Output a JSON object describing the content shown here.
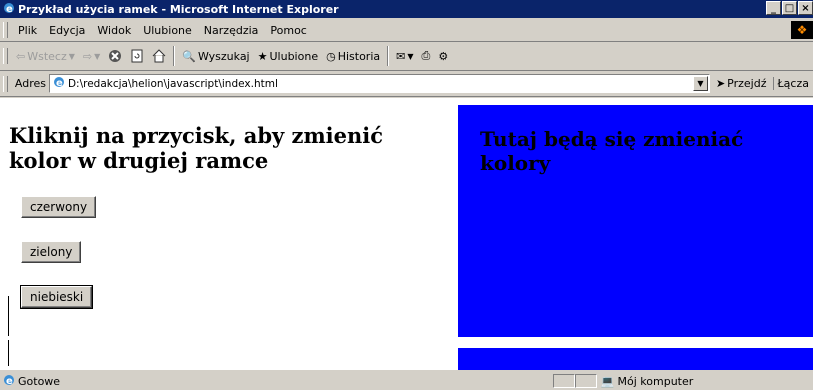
{
  "window": {
    "title": "Przykład użycia ramek - Microsoft Internet Explorer",
    "controls": [
      "_",
      "□",
      "×"
    ]
  },
  "menu": [
    "Plik",
    "Edycja",
    "Widok",
    "Ulubione",
    "Narzędzia",
    "Pomoc"
  ],
  "toolbar": {
    "back_label": "Wstecz",
    "search_label": "Wyszukaj",
    "favorites_label": "Ulubione",
    "history_label": "Historia"
  },
  "address": {
    "label": "Adres",
    "value": "D:\\redakcja\\helion\\javascript\\index.html",
    "go_label": "Przejdź",
    "links_label": "Łącza"
  },
  "left_frame": {
    "heading": "Kliknij na przycisk, aby zmienić kolor w drugiej ramce",
    "buttons": [
      "czerwony",
      "zielony",
      "niebieski"
    ]
  },
  "right_frame": {
    "heading": "Tutaj będą się zmieniać kolory",
    "background": "#0000ff"
  },
  "status": {
    "text": "Gotowe",
    "zone": "Mój komputer"
  }
}
